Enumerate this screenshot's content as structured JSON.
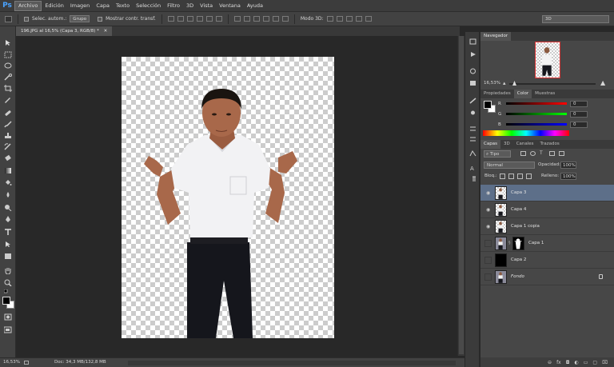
{
  "menubar": {
    "logo": "Ps",
    "items": [
      "Archivo",
      "Edición",
      "Imagen",
      "Capa",
      "Texto",
      "Selección",
      "Filtro",
      "3D",
      "Vista",
      "Ventana",
      "Ayuda"
    ]
  },
  "options": {
    "auto_select": "Selec. autom.:",
    "group": "Grupo",
    "show_transform": "Mostrar contr. transf.",
    "mode_3d": "Modo 3D:",
    "workspace": "3D"
  },
  "document": {
    "tab_title": "196.JPG al 16,5% (Capa 3, RGB/8) *"
  },
  "status": {
    "zoom": "16,53%",
    "doc_info": "Doc: 34,3 MB/132,8 MB"
  },
  "navigator": {
    "tab": "Navegador",
    "zoom": "16,53%"
  },
  "color_panel": {
    "tabs": [
      "Propiedades",
      "Color",
      "Muestras"
    ],
    "active_tab": "Color",
    "channels": [
      {
        "label": "R",
        "value": "0",
        "color": "#e02020"
      },
      {
        "label": "G",
        "value": "0",
        "color": "#20c020"
      },
      {
        "label": "B",
        "value": "0",
        "color": "#2060e0"
      }
    ]
  },
  "layers_panel": {
    "tabs": [
      "Capas",
      "3D",
      "Canales",
      "Trazados"
    ],
    "active_tab": "Capas",
    "filter": "Tipo",
    "blend_mode": "Normal",
    "opacity_label": "Opacidad:",
    "opacity": "100%",
    "lock_label": "Bloq.:",
    "fill_label": "Relleno:",
    "fill": "100%",
    "layers": [
      {
        "name": "Capa 3",
        "visible": true,
        "selected": true
      },
      {
        "name": "Capa 4",
        "visible": true,
        "selected": false
      },
      {
        "name": "Capa 1 copia",
        "visible": true,
        "selected": false
      },
      {
        "name": "Capa 1",
        "visible": false,
        "selected": false
      },
      {
        "name": "Capa 2",
        "visible": false,
        "selected": false
      },
      {
        "name": "Fondo",
        "visible": false,
        "selected": false
      }
    ]
  }
}
